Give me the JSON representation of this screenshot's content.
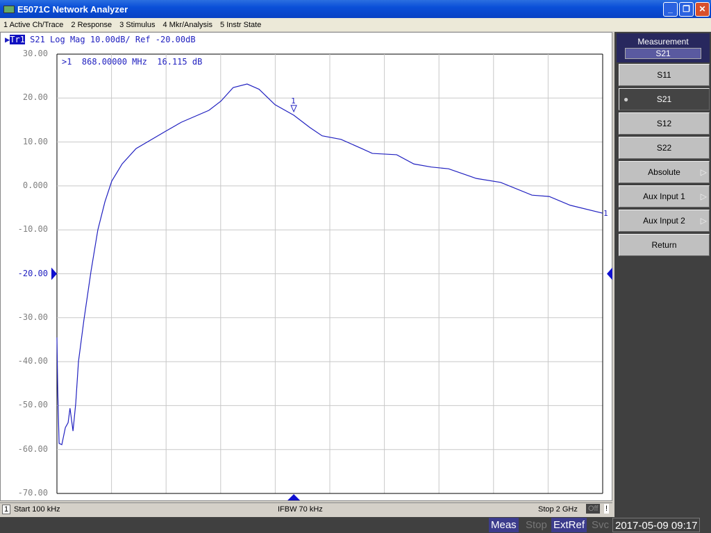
{
  "window": {
    "title": "E5071C Network Analyzer",
    "minimize": "_",
    "restore": "❐",
    "close": "✕"
  },
  "menu": [
    "1 Active Ch/Trace",
    "2 Response",
    "3 Stimulus",
    "4 Mkr/Analysis",
    "5 Instr State"
  ],
  "trace_header": {
    "trace": "Tr1",
    "text": " S21 Log Mag 10.00dB/ Ref -20.00dB"
  },
  "marker_readout": ">1  868.00000 MHz  16.115 dB",
  "marker_label": "1",
  "bottom": {
    "channel": "1",
    "start": "Start 100 kHz",
    "ifbw": "IFBW 70 kHz",
    "stop": "Stop 2 GHz",
    "off": "Off",
    "warn": "!"
  },
  "status": {
    "meas": "Meas",
    "stop": "Stop",
    "extref": "ExtRef",
    "svc": "Svc",
    "datetime": "2017-05-09 09:17"
  },
  "softkeys": {
    "title": "Measurement",
    "value": "S21",
    "items": [
      {
        "label": "S11"
      },
      {
        "label": "S21",
        "selected": true
      },
      {
        "label": "S12"
      },
      {
        "label": "S22"
      },
      {
        "label": "Absolute",
        "submenu": true
      },
      {
        "label": "Aux Input 1",
        "submenu": true
      },
      {
        "label": "Aux Input 2",
        "submenu": true
      },
      {
        "label": "Return"
      }
    ]
  },
  "colors": {
    "trace": "#2020c0",
    "grid": "#c8c8c8"
  },
  "chart_data": {
    "type": "line",
    "xlim_mhz": [
      0.1,
      2000
    ],
    "ylim_db": [
      -70,
      30
    ],
    "ref_db": -20,
    "scale_db_per_div": 10,
    "grid": true,
    "y_ticks": [
      "30.00",
      "20.00",
      "10.00",
      "0.000",
      "-10.00",
      "-20.00",
      "-30.00",
      "-40.00",
      "-50.00",
      "-60.00",
      "-70.00"
    ],
    "series": [
      {
        "name": "S21",
        "x_mhz": [
          0.1,
          3,
          8,
          18,
          31,
          41,
          48,
          59,
          69,
          79,
          99,
          125,
          150,
          176,
          201,
          239,
          290,
          400,
          456,
          557,
          601,
          646,
          697,
          741,
          799,
          868,
          927,
          972,
          1041,
          1117,
          1156,
          1245,
          1308,
          1372,
          1435,
          1537,
          1626,
          1741,
          1804,
          1881,
          2000
        ],
        "db": [
          -34.5,
          -46.3,
          -58.6,
          -58.9,
          -55,
          -53.9,
          -50.6,
          -55.8,
          -49.5,
          -40,
          -30.5,
          -19.4,
          -10,
          -3.6,
          1.1,
          5,
          8.5,
          12.5,
          14.5,
          17.2,
          19.3,
          22.4,
          23.2,
          22,
          18.5,
          16.1,
          13.3,
          11.4,
          10.6,
          8.5,
          7.4,
          7.1,
          5,
          4.3,
          3.9,
          1.7,
          0.8,
          -2.1,
          -2.4,
          -4.4,
          -6.2
        ]
      }
    ],
    "markers": [
      {
        "id": "1",
        "x_mhz": 868,
        "db": 16.115
      }
    ]
  }
}
